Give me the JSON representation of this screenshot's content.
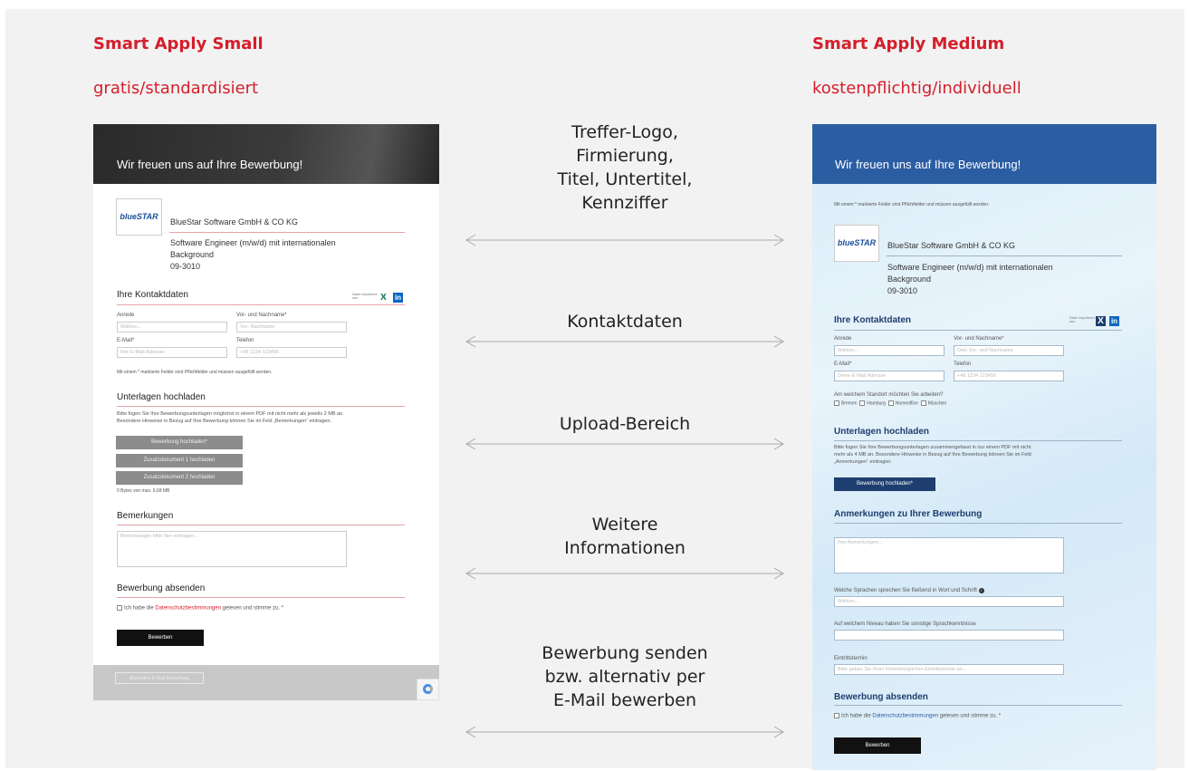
{
  "left": {
    "title": "Smart Apply Small",
    "subtitle": "gratis/standardisiert",
    "form": {
      "header": "Wir freuen uns auf Ihre Bewerbung!",
      "logo_text": "blueSTAR",
      "company": "BlueStar Software GmbH & CO KG",
      "job_line1": "Software Engineer (m/w/d) mit internationalen",
      "job_line2": "Background",
      "job_code": "09-3010",
      "contact_title": "Ihre Kontaktdaten",
      "social_hint_1": "Daten importieren",
      "social_hint_2": "aus:",
      "xing": "X",
      "linkedin": "in",
      "anrede_label": "Anrede",
      "anrede_value": "Wählen...",
      "name_label": "Vor- und Nachname*",
      "name_placeholder": "Vor- Nachname",
      "email_label": "E-Mail*",
      "email_placeholder": "Ihre E-Mail-Adresse",
      "phone_label": "Telefon",
      "phone_placeholder": "+49 1234 123456",
      "required_note": "Mit einem * markierte Felder sind Pflichtfelder und müssen ausgefüllt werden.",
      "upload_title": "Unterlagen hochladen",
      "upload_text_1": "Bitte fügen Sie Ihre Bewerbungsunterlagen möglichst in einem PDF mit nicht mehr als jeweils 2 MB an.",
      "upload_text_2": "Besondere Hinweise in Bezug auf Ihre Bewerbung können Sie im Feld „Bemerkungen“ eintragen.",
      "btn_upload": "Bewerbung hochladen*",
      "btn_add1": "Zusatzdokument 1 hochladen",
      "btn_add2": "Zusatzdokument 2 hochladen",
      "bytes": "0 Bytes von max. 6,68 MB",
      "remarks_title": "Bemerkungen",
      "remarks_placeholder": "Bemerkungen bitte hier eintragen...",
      "submit_title": "Bewerbung absenden",
      "privacy_pre": "Ich habe die ",
      "privacy_link": "Datenschutzbestimmungen",
      "privacy_post": " gelesen und stimme zu. *",
      "submit_btn": "Bewerben",
      "alt_btn": "Alternative E-Mail-Bewerbung"
    }
  },
  "right": {
    "title": "Smart Apply Medium",
    "subtitle": "kostenpflichtig/individuell",
    "form": {
      "header": "Wir freuen uns auf Ihre Bewerbung!",
      "required_note": "Mit einem * markierte Felder sind Pflichtfelder und müssen ausgefüllt werden.",
      "logo_text": "blueSTAR",
      "company": "BlueStar Software GmbH & CO KG",
      "job_line1": "Software Engineer (m/w/d) mit internationalen",
      "job_line2": "Background",
      "job_code": "09-3010",
      "contact_title": "Ihre Kontaktdaten",
      "social_hint_1": "Daten importieren",
      "social_hint_2": "aus:",
      "xing": "X",
      "linkedin": "in",
      "anrede_label": "Anrede",
      "anrede_value": "Wählen...",
      "name_label": "Vor- und Nachname*",
      "name_placeholder": "Dein Vor- und Nachname",
      "email_label": "E-Mail*",
      "email_placeholder": "Deine E-Mail Adresse",
      "phone_label": "Telefon",
      "phone_placeholder": "+49 1234 123456",
      "location_q": "Am welchem Standort möchten Sie arbeiten?",
      "locations": [
        "Bremen",
        "Hamburg",
        "Homeoffice",
        "München"
      ],
      "upload_title": "Unterlagen hochladen",
      "upload_text_1": "Bitte fügen Sie Ihre Bewerbungsunterlagen zusammengefasst in nur einem PDF mit nicht",
      "upload_text_2": "mehr als 4 MB an. Besondere Hinweise in Bezug auf Ihre Bewerbung können Sie im Feld",
      "upload_text_3": "„Anmerkungen“ eintragen.",
      "btn_upload": "Bewerbung hochladen*",
      "remarks_title": "Anmerkungen zu Ihrer Bewerbung",
      "remarks_placeholder": "Ihre Anmerkungen...",
      "languages_q": "Welche Sprachen sprechen Sie fließend in Wort und Schrift",
      "languages_value": "Wählen...",
      "level_q": "Auf welchem Niveau haben Sie sonstige Sprachkenntnisse",
      "start_label": "Eintrittstermin",
      "start_placeholder": "Bitte geben Sie Ihren frühestmöglichen Eintrittstermin an...",
      "submit_title": "Bewerbung absenden",
      "privacy_pre": "Ich habe die ",
      "privacy_link": "Datenschutzbestimmungen",
      "privacy_post": " gelesen und stimme zu. *",
      "submit_btn": "Bewerben"
    }
  },
  "comparison": [
    {
      "lines": [
        "Treffer-Logo,",
        "Firmierung,",
        "Titel, Untertitel,",
        "Kennziffer"
      ]
    },
    {
      "lines": [
        "Kontaktdaten"
      ]
    },
    {
      "lines": [
        "Upload-Bereich"
      ]
    },
    {
      "lines": [
        "Weitere",
        "Informationen"
      ]
    },
    {
      "lines": [
        "Bewerbung senden",
        "bzw. alternativ per",
        "E-Mail bewerben"
      ]
    }
  ],
  "colors": {
    "accent_red": "#d51e2b",
    "medium_blue": "#2b5da3"
  }
}
